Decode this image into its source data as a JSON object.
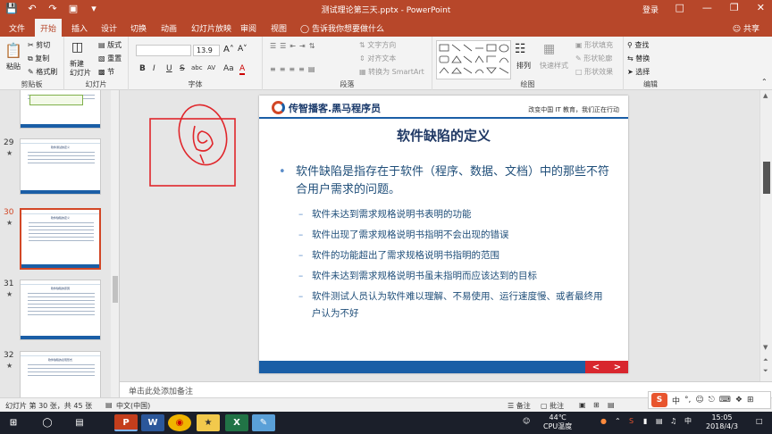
{
  "titlebar": {
    "title": "测试理论第三天.pptx - PowerPoint",
    "login": "登录",
    "qat": [
      "save-icon",
      "undo-icon",
      "redo-icon",
      "present-icon",
      "customize-icon"
    ]
  },
  "tabs": {
    "items": [
      "文件",
      "开始",
      "插入",
      "设计",
      "切换",
      "动画",
      "幻灯片放映",
      "审阅",
      "视图"
    ],
    "active": "开始",
    "tell_me": "告诉我你想要做什么",
    "share": "共享"
  },
  "ribbon": {
    "clipboard": {
      "paste": "粘贴",
      "cut": "剪切",
      "copy": "复制",
      "format_painter": "格式刷",
      "label": "剪贴板"
    },
    "slides": {
      "new_slide": "新建\n幻灯片",
      "layout": "版式",
      "reset": "重置",
      "section": "节",
      "label": "幻灯片"
    },
    "font": {
      "name": "",
      "size": "13.9",
      "label": "字体",
      "buttons": [
        "B",
        "I",
        "U",
        "S",
        "abc",
        "AV",
        "Aa",
        "A"
      ]
    },
    "paragraph": {
      "text_direction": "文字方向",
      "align_text": "对齐文本",
      "convert_smartart": "转换为 SmartArt",
      "label": "段落"
    },
    "drawing": {
      "arrange": "排列",
      "quick_styles": "快速样式",
      "shape_fill": "形状填充",
      "shape_outline": "形状轮廓",
      "shape_effects": "形状效果",
      "label": "绘图"
    },
    "editing": {
      "find": "查找",
      "replace": "替换",
      "select": "选择",
      "label": "编辑"
    }
  },
  "thumbnails": [
    {
      "num": "",
      "title": ""
    },
    {
      "num": "29",
      "title": "软件测试的定义"
    },
    {
      "num": "30",
      "title": "软件缺陷的定义",
      "selected": true
    },
    {
      "num": "31",
      "title": "软件缺陷的原因"
    },
    {
      "num": "32",
      "title": "软件缺陷的表现形式"
    }
  ],
  "slide": {
    "brand": "传智播客.黑马程序员",
    "motto": "改变中国 IT 教育，我们正在行动",
    "title": "软件缺陷的定义",
    "bullet": "软件缺陷是指存在于软件（程序、数据、文档）中的那些不符合用户需求的问题。",
    "subbullets": [
      "软件未达到需求规格说明书表明的功能",
      "软件出现了需求规格说明书指明不会出现的错误",
      "软件的功能超出了需求规格说明书指明的范围",
      "软件未达到需求规格说明书虽未指明而应该达到的目标",
      "软件测试人员认为软件难以理解、不易使用、运行速度慢、或者最终用户认为不好"
    ],
    "nav_prev": "<",
    "nav_next": ">"
  },
  "notes": {
    "placeholder": "单击此处添加备注"
  },
  "statusbar": {
    "slide_info": "幻灯片 第 30 张，共 45 张",
    "language": "中文(中国)",
    "notes": "备注",
    "comments": "批注"
  },
  "taskbar": {
    "weather_temp": "44℃",
    "weather_label": "CPU温度",
    "time": "15:05",
    "date": "2018/4/3",
    "apps": [
      "windows-start-icon",
      "search-icon",
      "task-view-icon",
      "powerpoint-icon",
      "word-icon",
      "chrome-icon",
      "sketch-icon",
      "excel-icon",
      "notepad-icon"
    ]
  },
  "ime": {
    "mode": "中"
  },
  "colors": {
    "accent": "#b7472a",
    "slide_blue": "#1a5ea6",
    "title_blue": "#1f3864",
    "annotation_red": "#e0262b"
  }
}
